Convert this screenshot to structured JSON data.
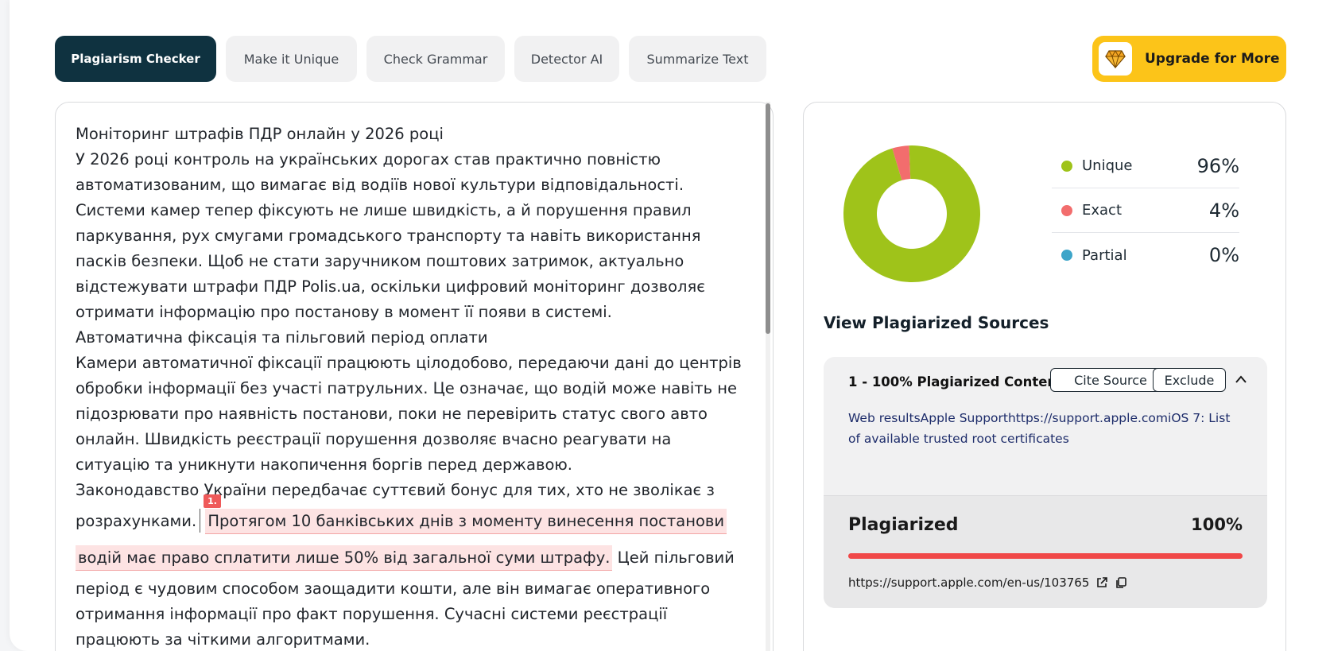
{
  "tabs": [
    {
      "label": "Plagiarism Checker",
      "active": true
    },
    {
      "label": "Make it Unique",
      "active": false
    },
    {
      "label": "Check Grammar",
      "active": false
    },
    {
      "label": "Detector AI",
      "active": false
    },
    {
      "label": "Summarize Text",
      "active": false
    }
  ],
  "upgrade": {
    "label": "Upgrade for More",
    "icon": "diamond-icon"
  },
  "editor": {
    "lines": [
      "Моніторинг штрафів ПДР онлайн у 2026 році",
      "У 2026 році контроль на українських дорогах став практично повністю",
      "автоматизованим, що вимагає від водіїв нової культури відповідальності.",
      "Системи камер тепер фіксують не лише швидкість, а й порушення правил",
      "паркування, рух смугами громадського транспорту та навіть використання",
      "пасків безпеки. Щоб не стати заручником поштових затримок, актуально",
      "відстежувати штрафи ПДР Polis.ua, оскільки цифровий моніторинг дозволяє",
      "отримати інформацію про постанову в момент її появи в системі.",
      "Автоматична фіксація та пільговий період оплати",
      "Камери автоматичної фіксації працюють цілодобово, передаючи дані до центрів",
      "обробки інформації без участі патрульних. Це означає, що водій може навіть не",
      "підозрювати про наявність постанови, поки не перевірить статус свого авто",
      "онлайн. Швидкість реєстрації порушення дозволяє вчасно реагувати на",
      "ситуацію та уникнути накопичення боргів перед державою.",
      "Законодавство України передбачає суттєвий бонус для тих, хто не зволікає з"
    ],
    "hl_prefix": "розрахунками.",
    "hl_text_1": "Протягом 10 банківських днів з моменту винесення постанови",
    "hl_text_2": "водій має право сплатити лише 50% від загальної суми штрафу.",
    "hl_suffix": " Цей пільговий",
    "badge": "1.",
    "lines_after": [
      "період є чудовим способом заощадити кошти, але він вимагає оперативного",
      "отримання інформації про факт порушення. Сучасні системи реєстрації",
      "працюють за чіткими алгоритмами."
    ]
  },
  "stats": {
    "legend": [
      {
        "label": "Unique",
        "value": "96%",
        "color": "#9fc31a"
      },
      {
        "label": "Exact",
        "value": "4%",
        "color": "#f26d6d"
      },
      {
        "label": "Partial",
        "value": "0%",
        "color": "#3da5c9"
      }
    ],
    "chart_data": {
      "type": "pie",
      "categories": [
        "Unique",
        "Exact",
        "Partial"
      ],
      "values": [
        96,
        4,
        0
      ]
    }
  },
  "sources": {
    "title": "View Plagiarized Sources",
    "item": {
      "heading": "1 - 100% Plagiarized Content",
      "cite_label": "Cite Source",
      "exclude_label": "Exclude",
      "snippet": "Web resultsApple Supporthttps://support.apple.comiOS 7: List of available trusted root certificates",
      "plag_label": "Plagiarized",
      "plag_value": "100%",
      "plag_fraction": 1.0,
      "url": "https://support.apple.com/en-us/103765"
    }
  }
}
